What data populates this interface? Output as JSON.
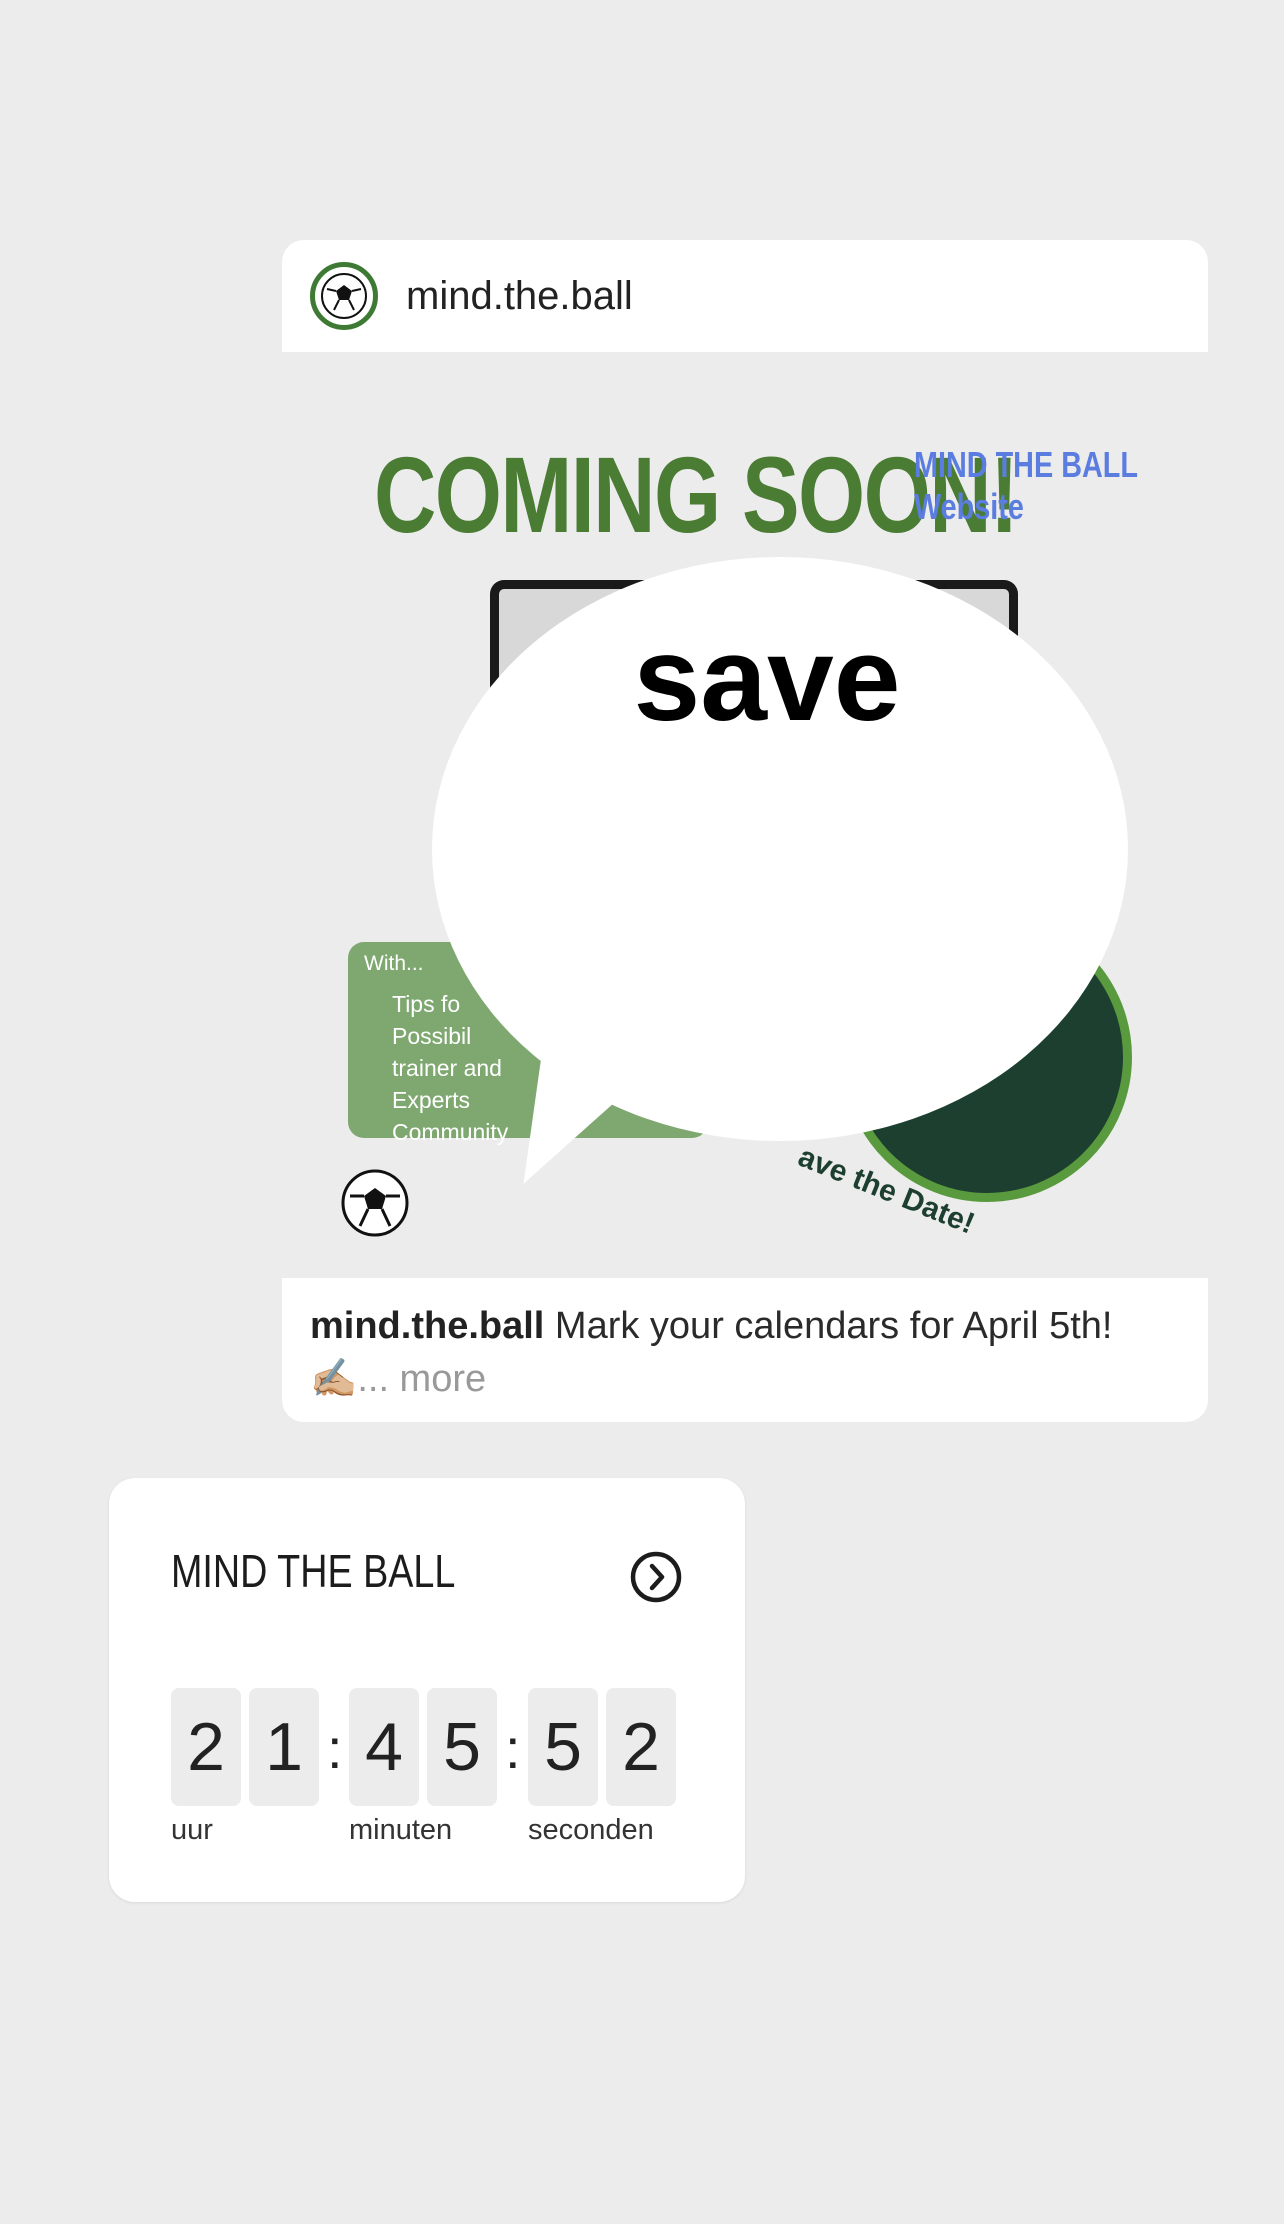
{
  "post": {
    "username": "mind.the.ball",
    "headline": "COMING SOON!",
    "headline_side_line1": "MIND THE BALL",
    "headline_side_line2": "Website",
    "features_intro": "With...",
    "features": [
      "Tips fo",
      "Possibil",
      "trainer and",
      "Experts",
      "Community"
    ],
    "disc_text": "ave the Date!",
    "sticker_word": "save",
    "caption_user": "mind.the.ball",
    "caption_text": "Mark your calendars for April 5th!",
    "caption_emoji": "✍🏼",
    "caption_more": "... more"
  },
  "countdown": {
    "title": "MIND THE BALL",
    "hours": [
      "2",
      "1"
    ],
    "minutes": [
      "4",
      "5"
    ],
    "seconds": [
      "5",
      "2"
    ],
    "separator": ":",
    "unit_hours": "uur",
    "unit_minutes": "minuten",
    "unit_seconds": "seconden"
  },
  "icons": {
    "avatar": "soccer-ball-logo",
    "countdown_link": "chevron-right-circle-icon"
  },
  "colors": {
    "background": "#ececec",
    "brand_green": "#4a7c33",
    "accent_blue": "#5b7de0",
    "dark_green": "#1d3f30"
  }
}
